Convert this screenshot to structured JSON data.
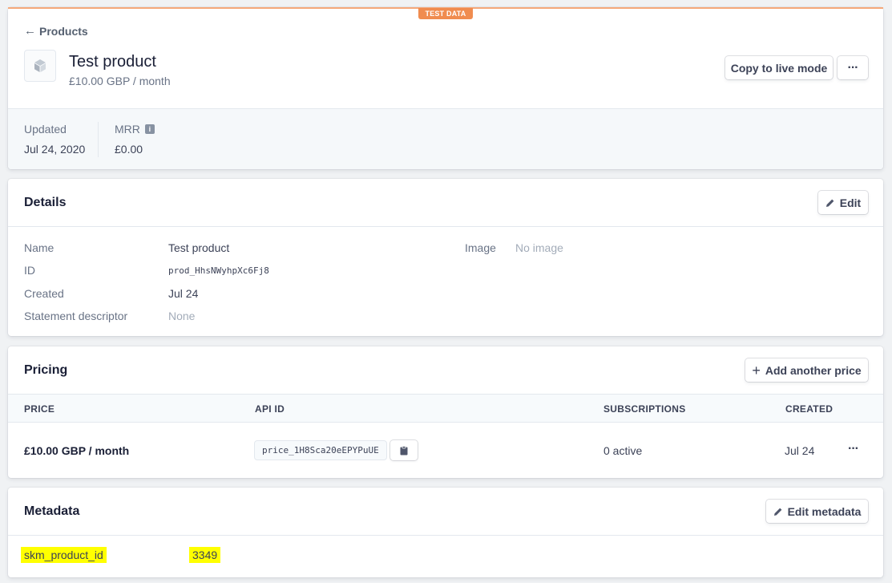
{
  "badge": "TEST DATA",
  "header": {
    "back_label": "Products",
    "title": "Test product",
    "subtitle": "£10.00 GBP / month",
    "copy_live_label": "Copy to live mode",
    "more_label": "···"
  },
  "stats": {
    "updated_label": "Updated",
    "updated_value": "Jul 24, 2020",
    "mrr_label": "MRR",
    "mrr_value": "£0.00",
    "info_glyph": "i"
  },
  "details": {
    "title": "Details",
    "edit_label": "Edit",
    "name_label": "Name",
    "name_value": "Test product",
    "id_label": "ID",
    "id_value": "prod_HhsNWyhpXc6Fj8",
    "created_label": "Created",
    "created_value": "Jul 24",
    "descriptor_label": "Statement descriptor",
    "descriptor_value": "None",
    "image_label": "Image",
    "image_value": "No image"
  },
  "pricing": {
    "title": "Pricing",
    "add_price_label": "Add another price",
    "columns": [
      "PRICE",
      "API ID",
      "SUBSCRIPTIONS",
      "CREATED"
    ],
    "rows": [
      {
        "price": "£10.00 GBP / month",
        "api_id": "price_1H8Sca20eEPYPuUE",
        "subscriptions": "0 active",
        "created": "Jul 24",
        "more": "···"
      }
    ]
  },
  "metadata": {
    "title": "Metadata",
    "edit_label": "Edit metadata",
    "key": "skm_product_id",
    "value": "3349"
  },
  "colors": {
    "test_badge": "#f08c4f",
    "highlight": "#ffff00",
    "text_primary": "#1a1f36",
    "text_secondary": "#697386"
  },
  "icons": [
    "arrow-left-icon",
    "product-box-icon",
    "info-icon",
    "pencil-icon",
    "plus-icon",
    "clipboard-icon",
    "more-dots-icon"
  ]
}
